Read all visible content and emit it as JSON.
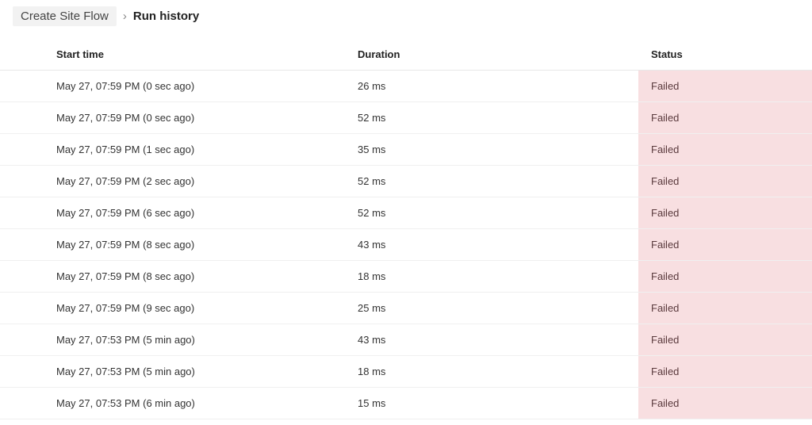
{
  "breadcrumb": {
    "parent": "Create Site Flow",
    "separator": "›",
    "current": "Run history"
  },
  "columns": {
    "start_time": "Start time",
    "duration": "Duration",
    "status": "Status"
  },
  "chart_data": {
    "type": "table",
    "columns": [
      "Start time",
      "Duration",
      "Status"
    ],
    "rows": [
      {
        "start_time": "May 27, 07:59 PM (0 sec ago)",
        "duration": "26 ms",
        "status": "Failed"
      },
      {
        "start_time": "May 27, 07:59 PM (0 sec ago)",
        "duration": "52 ms",
        "status": "Failed"
      },
      {
        "start_time": "May 27, 07:59 PM (1 sec ago)",
        "duration": "35 ms",
        "status": "Failed"
      },
      {
        "start_time": "May 27, 07:59 PM (2 sec ago)",
        "duration": "52 ms",
        "status": "Failed"
      },
      {
        "start_time": "May 27, 07:59 PM (6 sec ago)",
        "duration": "52 ms",
        "status": "Failed"
      },
      {
        "start_time": "May 27, 07:59 PM (8 sec ago)",
        "duration": "43 ms",
        "status": "Failed"
      },
      {
        "start_time": "May 27, 07:59 PM (8 sec ago)",
        "duration": "18 ms",
        "status": "Failed"
      },
      {
        "start_time": "May 27, 07:59 PM (9 sec ago)",
        "duration": "25 ms",
        "status": "Failed"
      },
      {
        "start_time": "May 27, 07:53 PM (5 min ago)",
        "duration": "43 ms",
        "status": "Failed"
      },
      {
        "start_time": "May 27, 07:53 PM (5 min ago)",
        "duration": "18 ms",
        "status": "Failed"
      },
      {
        "start_time": "May 27, 07:53 PM (6 min ago)",
        "duration": "15 ms",
        "status": "Failed"
      }
    ]
  }
}
